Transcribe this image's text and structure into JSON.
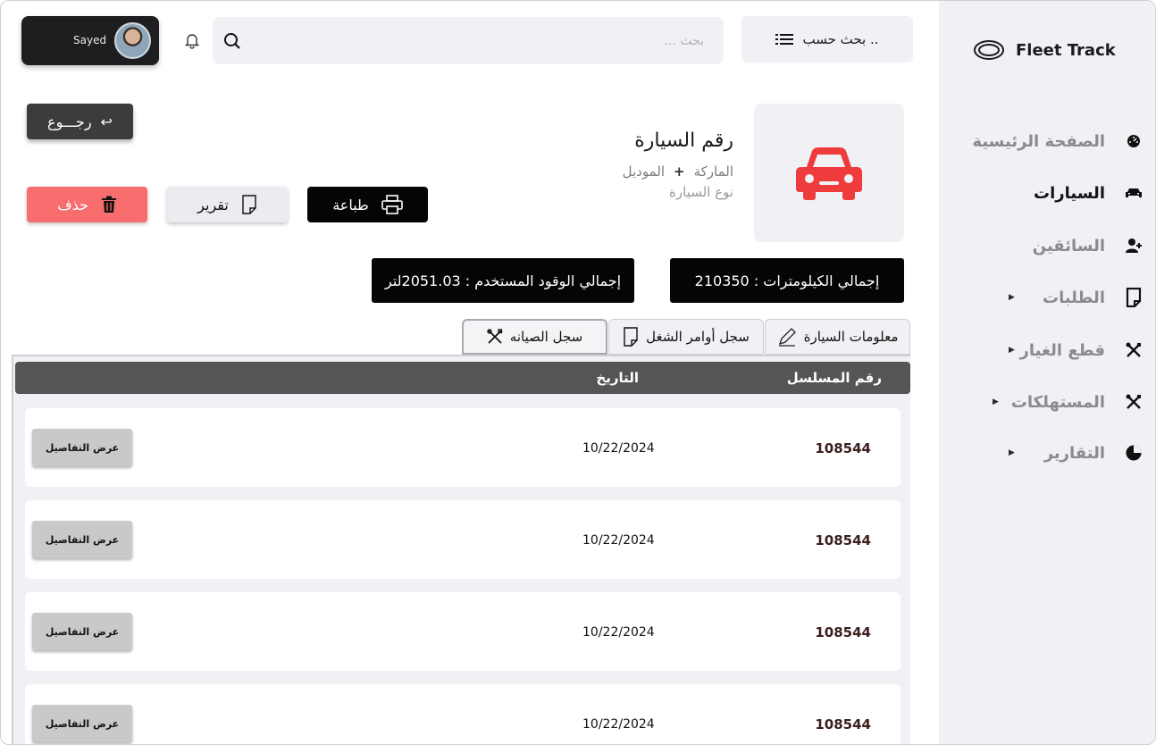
{
  "sidebar": {
    "brand": "Fleet Track",
    "items": [
      {
        "label": "الصفحة الرئيسية",
        "icon": "dashboard-icon",
        "active": false,
        "caret": false
      },
      {
        "label": "السيارات",
        "icon": "car-icon",
        "active": true,
        "caret": false
      },
      {
        "label": "السائقين",
        "icon": "user-add-icon",
        "active": false,
        "caret": false
      },
      {
        "label": "الطلبات",
        "icon": "document-icon",
        "active": false,
        "caret": true
      },
      {
        "label": "قطع الغيار",
        "icon": "tools-icon",
        "active": false,
        "caret": true
      },
      {
        "label": "المستهلكات",
        "icon": "tools-icon",
        "active": false,
        "caret": true
      },
      {
        "label": "التقارير",
        "icon": "pie-chart-icon",
        "active": false,
        "caret": true
      }
    ]
  },
  "header": {
    "user_name": "Sayed",
    "search_placeholder": "بحث ...",
    "filter_label": "بحث حسب .."
  },
  "vehicle": {
    "back_label": "رجـــوع",
    "title": "رقم السيارة",
    "brand": "الماركة",
    "plus": "+",
    "model": "الموديل",
    "type": "نوع السيارة",
    "accent_color": "#ef3b3b"
  },
  "actions": {
    "print": "طباعة",
    "report": "تقرير",
    "delete": "حذف"
  },
  "stats": {
    "km": "إجمالي الكيلومترات : 210350",
    "fuel": "إجمالي الوقود المستخدم : 2051.03لتر"
  },
  "tabs": {
    "info": "معلومات السيارة",
    "orders": "سجل أوامر الشغل",
    "maintenance": "سجل الصيانه"
  },
  "table": {
    "headers": {
      "serial": "رقم المسلسل",
      "date": "التاريخ"
    },
    "rows": [
      {
        "serial": "108544",
        "date": "10/22/2024",
        "action": "عرض التفاصيل"
      },
      {
        "serial": "108544",
        "date": "10/22/2024",
        "action": "عرض التفاصيل"
      },
      {
        "serial": "108544",
        "date": "10/22/2024",
        "action": "عرض التفاصيل"
      },
      {
        "serial": "108544",
        "date": "10/22/2024",
        "action": "عرض التفاصيل"
      }
    ]
  }
}
